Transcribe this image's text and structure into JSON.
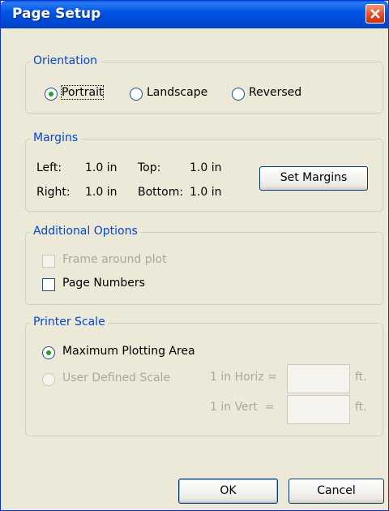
{
  "window": {
    "title": "Page Setup"
  },
  "orientation": {
    "group_title": "Orientation",
    "options": [
      "Portrait",
      "Landscape",
      "Reversed"
    ],
    "selected": "Portrait"
  },
  "margins": {
    "group_title": "Margins",
    "left_label": "Left:",
    "left_value": "1.0 in",
    "top_label": "Top:",
    "top_value": "1.0 in",
    "right_label": "Right:",
    "right_value": "1.0 in",
    "bottom_label": "Bottom:",
    "bottom_value": "1.0 in",
    "set_margins_label": "Set Margins"
  },
  "additional": {
    "group_title": "Additional Options",
    "frame_label": "Frame around plot",
    "frame_checked": false,
    "frame_enabled": false,
    "page_numbers_label": "Page Numbers",
    "page_numbers_checked": false
  },
  "scale": {
    "group_title": "Printer Scale",
    "max_area_label": "Maximum Plotting Area",
    "user_scale_label": "User Defined Scale",
    "selected": "Maximum Plotting Area",
    "horiz_label": "1 in Horiz =",
    "vert_label": "1 in Vert  =",
    "horiz_value": "",
    "vert_value": "",
    "unit": "ft."
  },
  "buttons": {
    "ok": "OK",
    "cancel": "Cancel"
  },
  "colors": {
    "title_bar": "#0054e3",
    "group_title": "#0046d5",
    "radio_dot": "#21a121",
    "close_button": "#e2461c"
  }
}
